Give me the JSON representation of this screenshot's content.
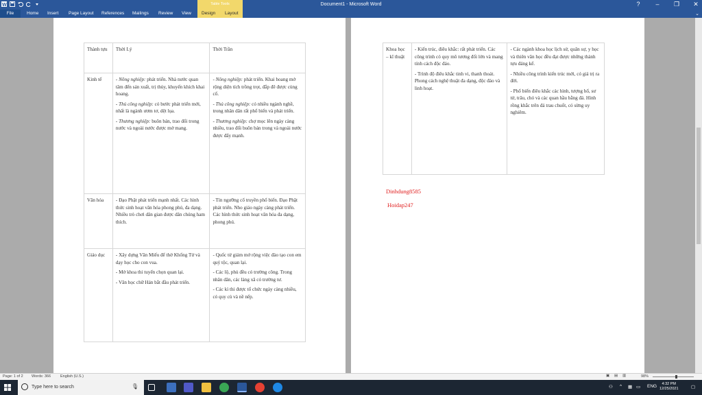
{
  "window": {
    "title": "Document1 - Microsoft Word",
    "controls": [
      "?",
      "–",
      "❐",
      "✕"
    ]
  },
  "ribbon": {
    "file_tab": "File",
    "tabs": [
      "Home",
      "Insert",
      "Page Layout",
      "References",
      "Mailings",
      "Review",
      "View"
    ],
    "context_group": "Table Tools",
    "context_tabs": [
      "Design",
      "Layout"
    ]
  },
  "page1": {
    "header": [
      "Thành tựu",
      "Thời Lý",
      "Thời Trần"
    ],
    "rows": [
      {
        "label": "Kinh tế",
        "ly": [
          {
            "em": "- Nông nghiệp:",
            "text": " phát triển. Nhà nước quan tâm đến sản xuất, trị thủy, khuyến khích khai hoang."
          },
          {
            "em": "- Thủ công nghiệp:",
            "text": " có bước phát triển mới, nhất là ngành ươm tơ, dệt lụa."
          },
          {
            "em": "- Thương nghiệp:",
            "text": " buôn bán, trao đổi trong nước và ngoài nước được mở mang."
          }
        ],
        "tran": [
          {
            "em": "- Nông nghiệp:",
            "text": " phát triển. Khai hoang mở rộng diện tích trồng trọt, đắp đê được củng cố."
          },
          {
            "em": "- Thủ công nghiệp:",
            "text": " có nhiều ngành nghề, trong nhân dân rất phổ biến và phát triển."
          },
          {
            "em": "- Thương nghiệp:",
            "text": " chợ mọc lên ngày càng nhiều, trao đổi buôn bán trong và ngoài nước được đẩy mạnh."
          }
        ]
      },
      {
        "label": "Văn hóa",
        "ly": [
          "- Đạo Phật phát triển mạnh nhất. Các hình thức sinh hoạt văn hóa phong phú, đa dạng. Nhiều trò chơi dân gian được dân chúng ham thích."
        ],
        "tran": [
          "- Tín ngưỡng cổ truyền phổ biến. Đạo Phật phát triển. Nho giáo ngày càng phát triển. Các hình thức sinh hoạt văn hóa đa dạng, phong phú."
        ]
      },
      {
        "label": "Giáo dục",
        "ly": [
          "- Xây dựng Văn Miếu để thờ Khổng Tử và dạy học cho con vua.",
          "- Mở khoa thi tuyển chọn quan lại.",
          "- Văn học chữ Hán bắt đầu phát triển."
        ],
        "tran": [
          "- Quốc tử giám mở rộng việc đào tạo con em quý tộc, quan lại.",
          "- Các lộ, phủ đều có trường công. Trong nhân dân, các làng xã có trường tư.",
          "- Các kì thi được tổ chức ngày càng nhiều, có quy củ và nề nếp."
        ]
      }
    ]
  },
  "page2": {
    "label": "Khoa học – kĩ thuật",
    "ly": [
      "- Kiến trúc, điêu khắc: rất phát triển. Các công trình có quy mô tương đối lớn và mang tính cách độc đáo.",
      "- Trình độ điêu khắc tinh vi, thanh thoát. Phong cách nghệ thuật đa dạng, độc đáo và linh hoạt."
    ],
    "tran": [
      "- Các ngành khoa học lịch sử, quân sự, y học và thiên văn học đều đạt được những thành tựu đáng kể.",
      "- Nhiều công trình kiến trúc mới, có giá trị ra đời.",
      "- Phổ biến điêu khắc các hình, tượng hổ, sư tử, trâu, chó và các quan hầu bằng đá. Hình rồng khắc trên đá trau chuốt, có sừng uy nghiêm."
    ],
    "signature1": "Dinhdung8585",
    "signature2": "Hoidap247"
  },
  "statusbar": {
    "page": "Page: 1 of 2",
    "words": "Words: 366",
    "language": "English (U.S.)",
    "zoom": "98%"
  },
  "taskbar": {
    "search_placeholder": "Type here to search",
    "lang": "ENG",
    "time": "4:32 PM",
    "date": "12/25/2021"
  },
  "colors": {
    "word_blue": "#2b579a",
    "table_tools": "#f2d86b",
    "signature": "#e02020"
  }
}
